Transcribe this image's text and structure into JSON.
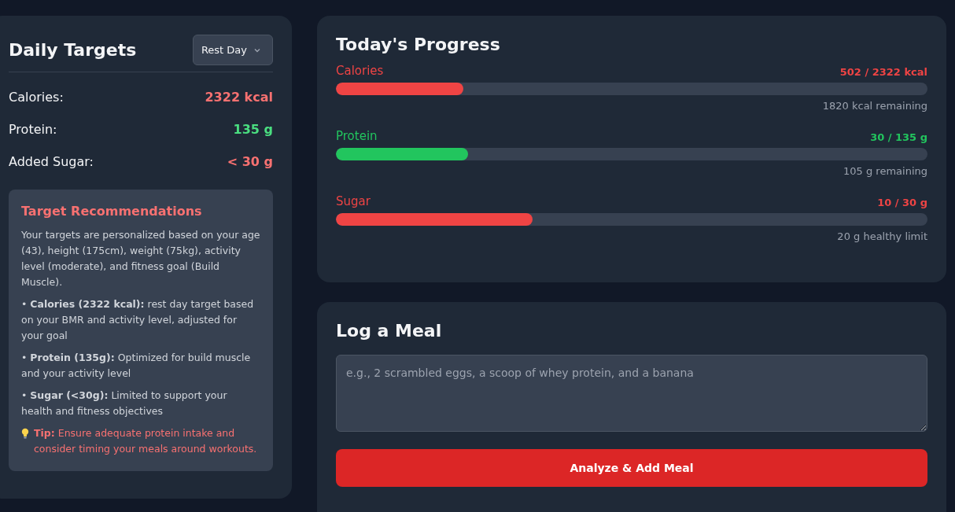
{
  "targets": {
    "title": "Daily Targets",
    "day_select": {
      "value": "Rest Day"
    },
    "rows": [
      {
        "label": "Calories:",
        "value": "2322 kcal",
        "color": "#f87171"
      },
      {
        "label": "Protein:",
        "value": "135 g",
        "color": "#4ade80"
      },
      {
        "label": "Added Sugar:",
        "value": "< 30 g",
        "color": "#f87171"
      }
    ],
    "recommendations": {
      "title": "Target Recommendations",
      "intro": "Your targets are personalized based on your age (43), height (175cm), weight (75kg), activity level (moderate), and fitness goal (Build Muscle).",
      "bullets": [
        "• **Calories (2322 kcal):** rest day target based on your BMR and activity level, adjusted for your goal",
        "• **Protein (135g):** Optimized for build muscle and your activity level",
        "• **Sugar (<30g):** Limited to support your health and fitness objectives"
      ],
      "tip": "**Tip:** Ensure adequate protein intake and consider timing your meals around workouts."
    }
  },
  "progress": {
    "title": "Today's Progress",
    "items": [
      {
        "name": "Calories",
        "reading": "502 / 2322 kcal",
        "level": 0.216,
        "note": "1820 kcal remaining",
        "color": "#ef4444"
      },
      {
        "name": "Protein",
        "reading": "30 / 135 g",
        "level": 0.223,
        "note": "105 g remaining",
        "color": "#22c55e"
      },
      {
        "name": "Sugar",
        "reading": "10 / 30 g",
        "level": 0.333,
        "note": "20 g healthy limit",
        "color": "#ef4444"
      }
    ]
  },
  "log_meal": {
    "title": "Log a Meal",
    "placeholder": "e.g., 2 scrambled eggs, a scoop of whey protein, and a banana",
    "button": "Analyze & Add Meal"
  }
}
